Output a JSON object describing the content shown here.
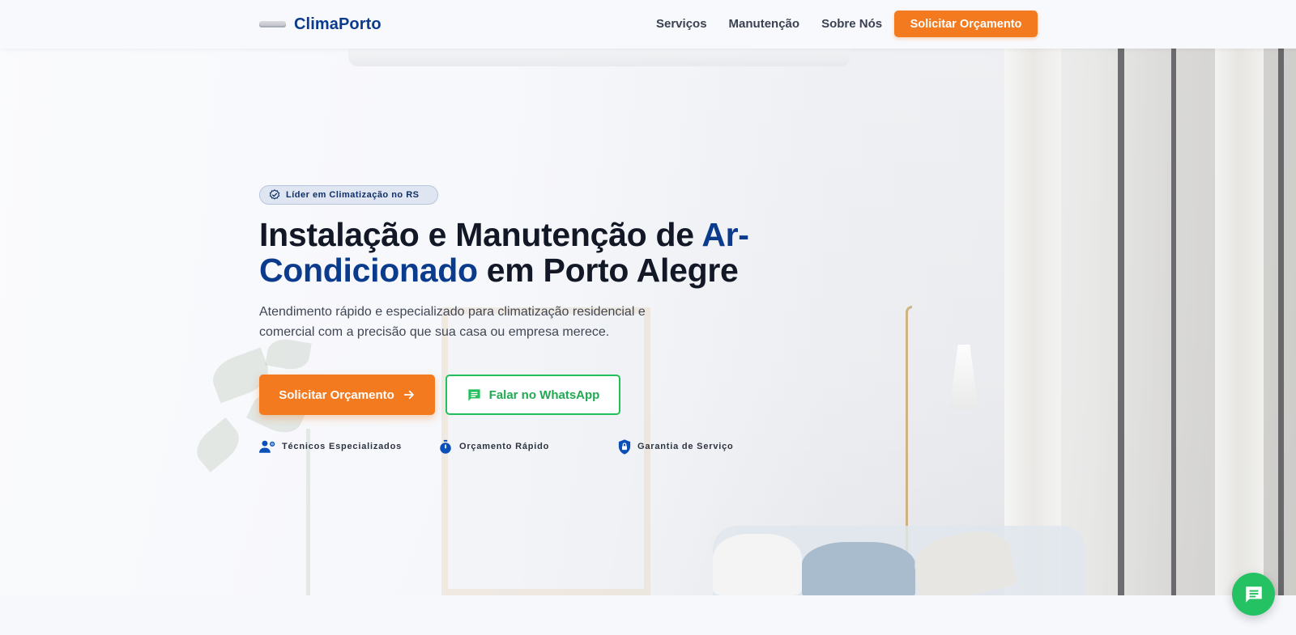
{
  "header": {
    "logo_text": "ClimaPorto",
    "nav": [
      "Serviços",
      "Manutenção",
      "Sobre Nós"
    ],
    "cta_label": "Solicitar Orçamento"
  },
  "hero": {
    "badge": "Líder em Climatização no RS",
    "headline_part1": "Instalação e Manutenção de ",
    "headline_accent": "Ar-Condicionado",
    "headline_part2": " em Porto Alegre",
    "subtitle": "Atendimento rápido e especializado para climatização residencial e comercial com a precisão que sua casa ou empresa merece.",
    "primary_button": "Solicitar Orçamento",
    "whatsapp_button": "Falar no WhatsApp",
    "features": [
      {
        "icon": "engineer-icon",
        "label": "Técnicos Especializados"
      },
      {
        "icon": "timer-icon",
        "label": "Orçamento Rápido"
      },
      {
        "icon": "shield-lock-icon",
        "label": "Garantia de Serviço"
      }
    ]
  },
  "chat_widget": {
    "icon": "chat-icon"
  },
  "colors": {
    "brand_blue": "#0b3b8c",
    "cta_orange": "#f47a1f",
    "whatsapp_green": "#22c05c"
  }
}
